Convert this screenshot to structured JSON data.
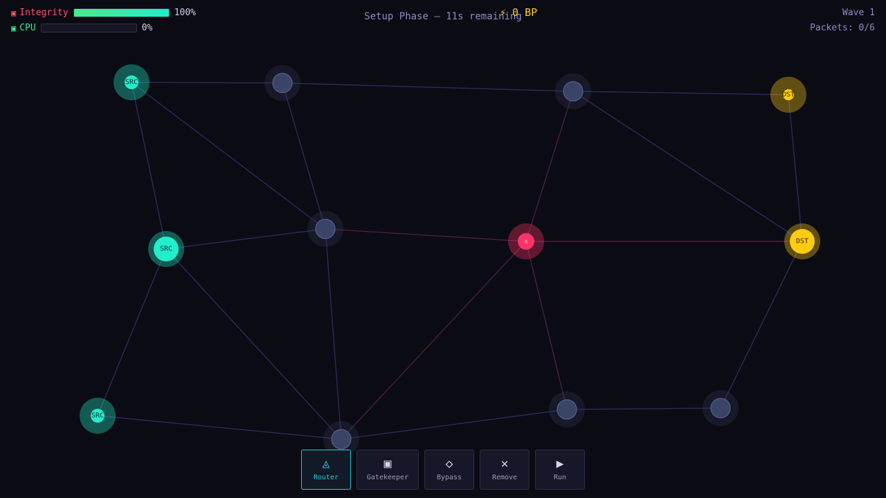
{
  "hud": {
    "integrity": {
      "icon": "▣",
      "label": "Integrity",
      "value_text": "100%",
      "level": 1.0
    },
    "cpu": {
      "icon": "▣",
      "label": "CPU",
      "value_text": "0%",
      "level": 0.0
    },
    "phase": "Setup Phase — 11s remaining",
    "bp": "⚡ 0 BP",
    "wave": "Wave 1",
    "packets": "Packets: 0/6"
  },
  "colors": {
    "background": "#0b0b14",
    "edge": "#2a2a5a",
    "edge_threat": "#4a1e38",
    "node_default": "#3a4466",
    "source": "#22eecc",
    "destination": "#ffcc11",
    "threat": "#ff3366",
    "accent": "#22ccdd"
  },
  "nodes": [
    {
      "id": "n1",
      "type": "source-small",
      "label": "SRC"
    },
    {
      "id": "n2",
      "type": "default",
      "label": ""
    },
    {
      "id": "n3",
      "type": "default",
      "label": ""
    },
    {
      "id": "n4",
      "type": "destination-small",
      "label": "DST"
    },
    {
      "id": "n5",
      "type": "source",
      "label": "SRC"
    },
    {
      "id": "n6",
      "type": "default",
      "label": ""
    },
    {
      "id": "n7",
      "type": "threat",
      "label": "⚠"
    },
    {
      "id": "n8",
      "type": "destination",
      "label": "DST"
    },
    {
      "id": "n9",
      "type": "source-small",
      "label": "SRC"
    },
    {
      "id": "n10",
      "type": "default",
      "label": ""
    },
    {
      "id": "n11",
      "type": "default",
      "label": ""
    },
    {
      "id": "n12",
      "type": "default",
      "label": ""
    }
  ],
  "edges": [
    [
      "n1",
      "n2"
    ],
    [
      "n2",
      "n3"
    ],
    [
      "n3",
      "n4"
    ],
    [
      "n1",
      "n5"
    ],
    [
      "n1",
      "n6"
    ],
    [
      "n2",
      "n6"
    ],
    [
      "n3",
      "n7"
    ],
    [
      "n3",
      "n8"
    ],
    [
      "n4",
      "n8"
    ],
    [
      "n5",
      "n6"
    ],
    [
      "n6",
      "n7"
    ],
    [
      "n7",
      "n8"
    ],
    [
      "n5",
      "n9"
    ],
    [
      "n5",
      "n10"
    ],
    [
      "n6",
      "n10"
    ],
    [
      "n7",
      "n10"
    ],
    [
      "n7",
      "n11"
    ],
    [
      "n8",
      "n12"
    ],
    [
      "n9",
      "n10"
    ],
    [
      "n10",
      "n11"
    ],
    [
      "n11",
      "n12"
    ]
  ],
  "toolbar": {
    "router": {
      "icon": "router-icon",
      "glyph": "◬",
      "label": "Router"
    },
    "gatekeeper": {
      "icon": "gatekeeper-icon",
      "glyph": "▣",
      "label": "Gatekeeper"
    },
    "bypass": {
      "icon": "bypass-icon",
      "glyph": "◇",
      "label": "Bypass"
    },
    "remove": {
      "icon": "close-icon",
      "glyph": "✕",
      "label": "Remove"
    },
    "run": {
      "icon": "play-icon",
      "glyph": "▶",
      "label": "Run"
    }
  }
}
